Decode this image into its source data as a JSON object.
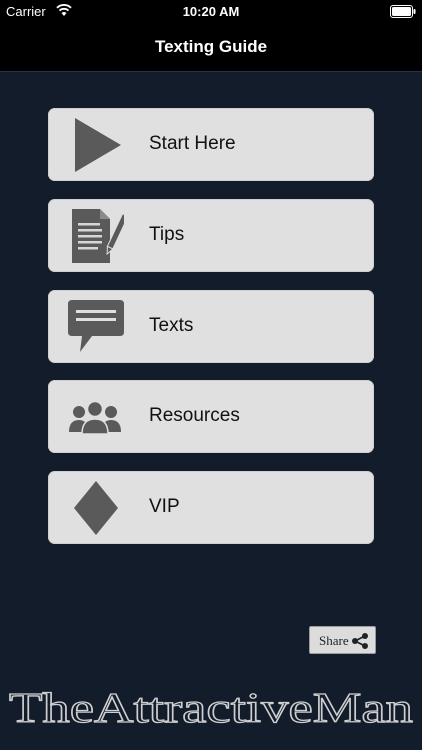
{
  "status_bar": {
    "carrier": "Carrier",
    "time": "10:20 AM",
    "icons": [
      "wifi-icon",
      "battery-icon"
    ]
  },
  "nav": {
    "title": "Texting Guide"
  },
  "menu": {
    "items": [
      {
        "label": "Start Here",
        "icon": "play-icon"
      },
      {
        "label": "Tips",
        "icon": "document-pencil-icon"
      },
      {
        "label": "Texts",
        "icon": "speech-bubble-icon"
      },
      {
        "label": "Resources",
        "icon": "people-group-icon"
      },
      {
        "label": "VIP",
        "icon": "diamond-icon"
      }
    ]
  },
  "share": {
    "label": "Share",
    "icon": "share-icon"
  },
  "brand": {
    "text": "TheAttractiveMan"
  },
  "colors": {
    "background": "#131c2b",
    "bar": "#000000",
    "button": "#e0e0e0",
    "icon": "#5a5a5a"
  }
}
